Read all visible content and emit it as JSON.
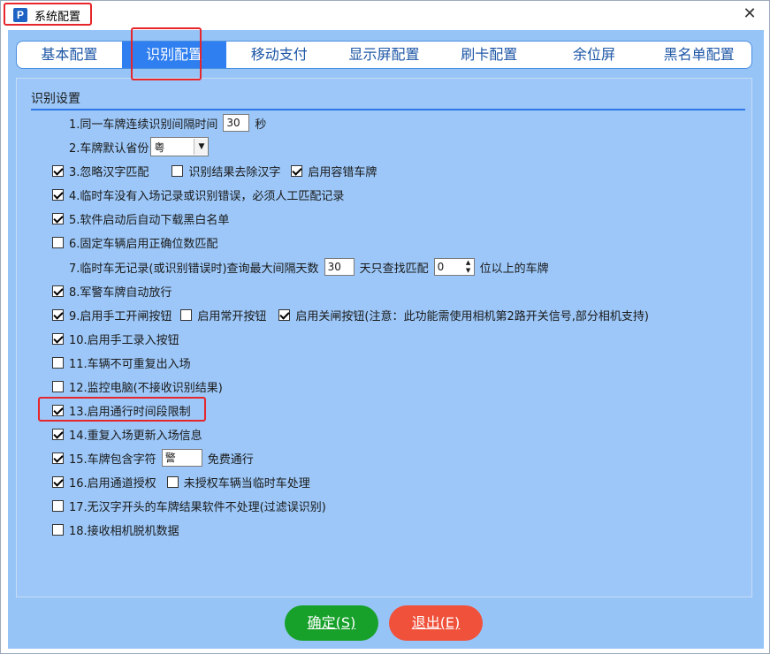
{
  "window": {
    "title": "系统配置",
    "app_icon_glyph": "P",
    "close_glyph": "✕"
  },
  "tabs": [
    {
      "label": "基本配置",
      "active": false
    },
    {
      "label": "识别配置",
      "active": true
    },
    {
      "label": "移动支付",
      "active": false
    },
    {
      "label": "显示屏配置",
      "active": false
    },
    {
      "label": "刷卡配置",
      "active": false
    },
    {
      "label": "余位屏",
      "active": false
    },
    {
      "label": "黑名单配置",
      "active": false
    }
  ],
  "group": {
    "title": "识别设置"
  },
  "settings": {
    "r1": {
      "label": "1.同一车牌连续识别间隔时间",
      "value": "30",
      "unit": "秒"
    },
    "r2": {
      "label": "2.车牌默认省份",
      "value": "粤"
    },
    "r3": {
      "label": "3.忽略汉字匹配",
      "checked": true,
      "opt1": {
        "label": "识别结果去除汉字",
        "checked": false
      },
      "opt2": {
        "label": "启用容错车牌",
        "checked": true
      }
    },
    "r4": {
      "label": "4.临时车没有入场记录或识别错误，必须人工匹配记录",
      "checked": true
    },
    "r5": {
      "label": "5.软件启动后自动下载黑白名单",
      "checked": true
    },
    "r6": {
      "label": "6.固定车辆启用正确位数匹配",
      "checked": false
    },
    "r7": {
      "label": "7.临时车无记录(或识别错误时)查询最大间隔天数",
      "days": "30",
      "mid": "天只查找匹配",
      "digits": "0",
      "suffix": "位以上的车牌"
    },
    "r8": {
      "label": "8.军警车牌自动放行",
      "checked": true
    },
    "r9": {
      "label": "9.启用手工开闸按钮",
      "checked": true,
      "opt1": {
        "label": "启用常开按钮",
        "checked": false
      },
      "opt2": {
        "label": "启用关闸按钮(注意：此功能需使用相机第2路开关信号,部分相机支持)",
        "checked": true
      }
    },
    "r10": {
      "label": "10.启用手工录入按钮",
      "checked": true
    },
    "r11": {
      "label": "11.车辆不可重复出入场",
      "checked": false
    },
    "r12": {
      "label": "12.监控电脑(不接收识别结果)",
      "checked": false
    },
    "r13": {
      "label": "13.启用通行时间段限制",
      "checked": true
    },
    "r14": {
      "label": "14.重复入场更新入场信息",
      "checked": true
    },
    "r15": {
      "label": "15.车牌包含字符",
      "checked": true,
      "value": "警",
      "suffix": "免费通行"
    },
    "r16": {
      "label": "16.启用通道授权",
      "checked": true,
      "opt1": {
        "label": "未授权车辆当临时车处理",
        "checked": false
      }
    },
    "r17": {
      "label": "17.无汉字开头的车牌结果软件不处理(过滤误识别)",
      "checked": false
    },
    "r18": {
      "label": "18.接收相机脱机数据",
      "checked": false
    }
  },
  "buttons": {
    "ok": "确定(S)",
    "exit": "退出(E)"
  },
  "colors": {
    "highlight": "#e6262b",
    "tab_active": "#2f7ff0",
    "ok": "#17a12a",
    "exit": "#f0513b"
  }
}
